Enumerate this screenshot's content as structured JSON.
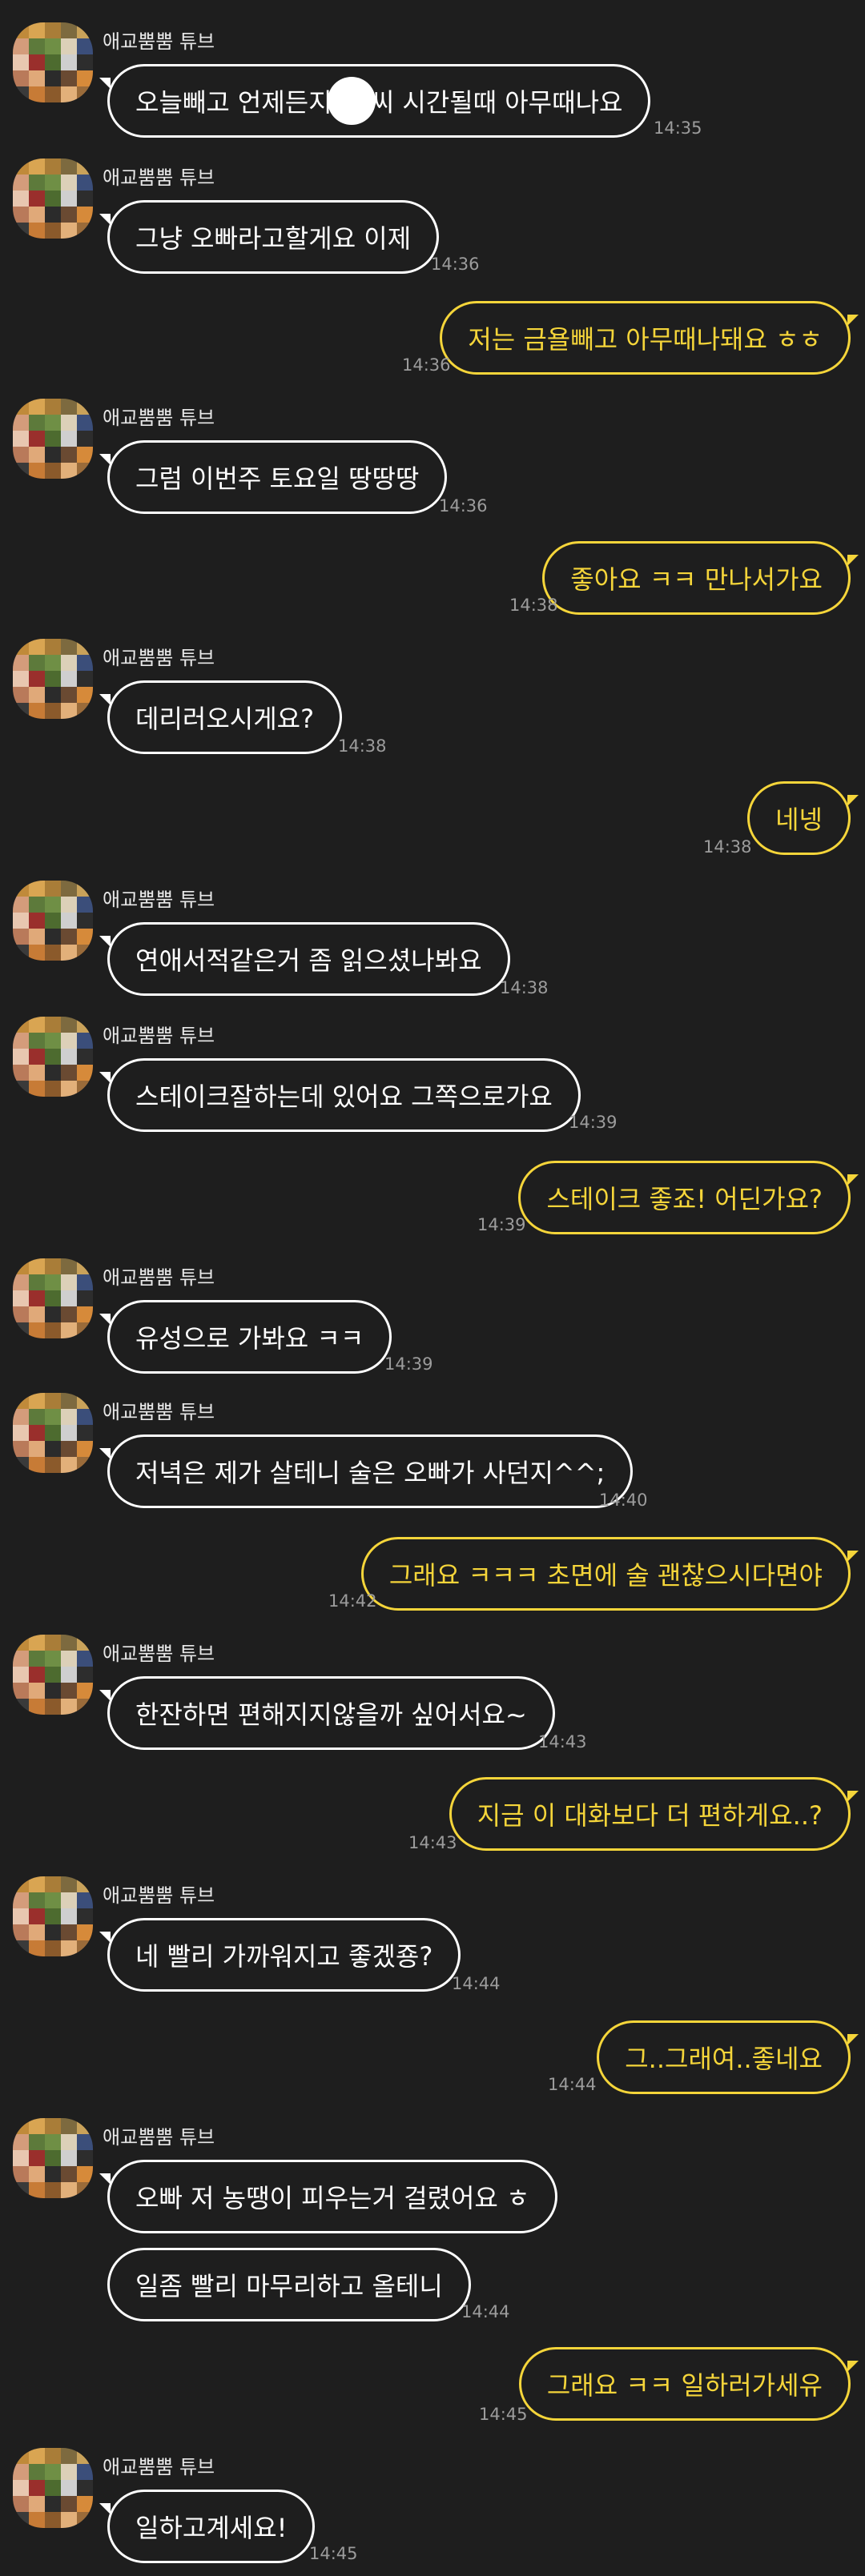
{
  "sender": "애교뿜뿜 튜브",
  "colors": {
    "background": "#1e1e1e",
    "incoming": "#ffffff",
    "outgoing": "#f5d53a",
    "time": "#9c9c9c"
  },
  "avatar_palette": [
    "#c08a3a",
    "#d9a552",
    "#a97d38",
    "#7d6a3f",
    "#c9a25a",
    "#d49c7b",
    "#5d7a3b",
    "#6f8f45",
    "#dcd0b8",
    "#3b4e7a",
    "#e8c7b0",
    "#9a2f2c",
    "#4d6b2f",
    "#cfcfcf",
    "#2d2d2d",
    "#b97a5a",
    "#e0a979",
    "#2b2b2b",
    "#6a4a32",
    "#d68a3a",
    "#3a3a3a",
    "#c77b36",
    "#8b5a2b",
    "#e2b07a",
    "#9a6b3a"
  ],
  "messages": [
    {
      "side": "in",
      "first": true,
      "text_a": "오늘빼고 언제든지 ",
      "text_b": "씨 시간될때 아무때나요",
      "time": "14:35"
    },
    {
      "side": "in",
      "first": true,
      "text": "그냥 오빠라고할게요 이제",
      "time": "14:36"
    },
    {
      "side": "out",
      "first": true,
      "text": "저는 금욜빼고 아무때나돼요 ㅎㅎ",
      "time": "14:36"
    },
    {
      "side": "in",
      "first": true,
      "text": "그럼 이번주 토요일 땅땅땅",
      "time": "14:36"
    },
    {
      "side": "out",
      "first": true,
      "text": "좋아요 ㅋㅋ 만나서가요",
      "time": "14:38"
    },
    {
      "side": "in",
      "first": true,
      "text": "데리러오시게요?",
      "time": "14:38"
    },
    {
      "side": "out",
      "first": true,
      "text": "네넹",
      "time": "14:38"
    },
    {
      "side": "in",
      "first": true,
      "text": "연애서적같은거 좀 읽으셨나봐요",
      "time": "14:38"
    },
    {
      "side": "in",
      "first": true,
      "text": "스테이크잘하는데 있어요 그쪽으로가요",
      "time": "14:39"
    },
    {
      "side": "out",
      "first": true,
      "text": "스테이크 좋죠! 어딘가요?",
      "time": "14:39"
    },
    {
      "side": "in",
      "first": true,
      "text": "유성으로 가봐요 ㅋㅋ",
      "time": "14:39"
    },
    {
      "side": "in",
      "first": true,
      "text": "저녁은 제가 살테니 술은 오빠가 사던지^^;",
      "time": "14:40"
    },
    {
      "side": "out",
      "first": true,
      "text": "그래요 ㅋㅋㅋ 초면에 술 괜찮으시다면야",
      "time": "14:42"
    },
    {
      "side": "in",
      "first": true,
      "text": "한잔하면 편해지지않을까 싶어서요~",
      "time": "14:43"
    },
    {
      "side": "out",
      "first": true,
      "text": "지금 이 대화보다 더 편하게요..?",
      "time": "14:43"
    },
    {
      "side": "in",
      "first": true,
      "text": "네 빨리 가까워지고 좋겠죵?",
      "time": "14:44"
    },
    {
      "side": "out",
      "first": true,
      "text": "그..그래여..좋네요",
      "time": "14:44"
    },
    {
      "side": "in",
      "first": true,
      "text": "오빠 저 농땡이 피우는거 걸렸어요 ㅎ",
      "time": ""
    },
    {
      "side": "in",
      "first": false,
      "text": "일좀 빨리 마무리하고 올테니",
      "time": "14:44"
    },
    {
      "side": "out",
      "first": true,
      "text": "그래요 ㅋㅋ 일하러가세유",
      "time": "14:45"
    },
    {
      "side": "in",
      "first": true,
      "text": "일하고계세요!",
      "time": "14:45"
    }
  ]
}
